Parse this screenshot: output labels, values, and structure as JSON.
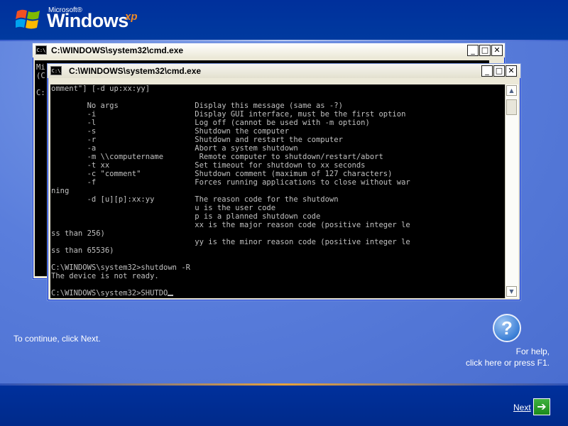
{
  "logo": {
    "brand_small": "Microsoft®",
    "brand_big": "Windows",
    "brand_suffix": "xp"
  },
  "back_window": {
    "title": "C:\\WINDOWS\\system32\\cmd.exe",
    "icon_text": "C:\\",
    "visible_text": "Mi\n(C\n\nC:",
    "buttons": {
      "minimize": "_",
      "maximize": "□",
      "close": "✕"
    }
  },
  "front_window": {
    "title": "C:\\WINDOWS\\system32\\cmd.exe",
    "icon_text": "C:\\",
    "buttons": {
      "minimize": "_",
      "maximize": "□",
      "close": "✕"
    },
    "scroll": {
      "up": "▲",
      "down": "▼"
    },
    "console_text": "omment\"] [-d up:xx:yy]\n\n        No args                 Display this message (same as -?)\n        -i                      Display GUI interface, must be the first option\n        -l                      Log off (cannot be used with -m option)\n        -s                      Shutdown the computer\n        -r                      Shutdown and restart the computer\n        -a                      Abort a system shutdown\n        -m \\\\computername        Remote computer to shutdown/restart/abort\n        -t xx                   Set timeout for shutdown to xx seconds\n        -c \"comment\"            Shutdown comment (maximum of 127 characters)\n        -f                      Forces running applications to close without war\nning\n        -d [u][p]:xx:yy         The reason code for the shutdown\n                                u is the user code\n                                p is a planned shutdown code\n                                xx is the major reason code (positive integer le\nss than 256)\n                                yy is the minor reason code (positive integer le\nss than 65536)\n\nC:\\WINDOWS\\system32>shutdown -R\nThe device is not ready.\n\nC:\\WINDOWS\\system32>SHUTDO"
  },
  "footer": {
    "continue_text": "To continue, click Next.",
    "help_icon_glyph": "?",
    "help_line1": "For help,",
    "help_line2": "click here or press F1.",
    "next_label": "Next",
    "next_arrow": "➔"
  },
  "colors": {
    "desktop_blue": "#5a7edc",
    "band_blue": "#00309c",
    "console_bg": "#000000",
    "console_fg": "#c0c0c0",
    "logo_xp": "#f08a24",
    "next_green": "#2a9a2a"
  }
}
